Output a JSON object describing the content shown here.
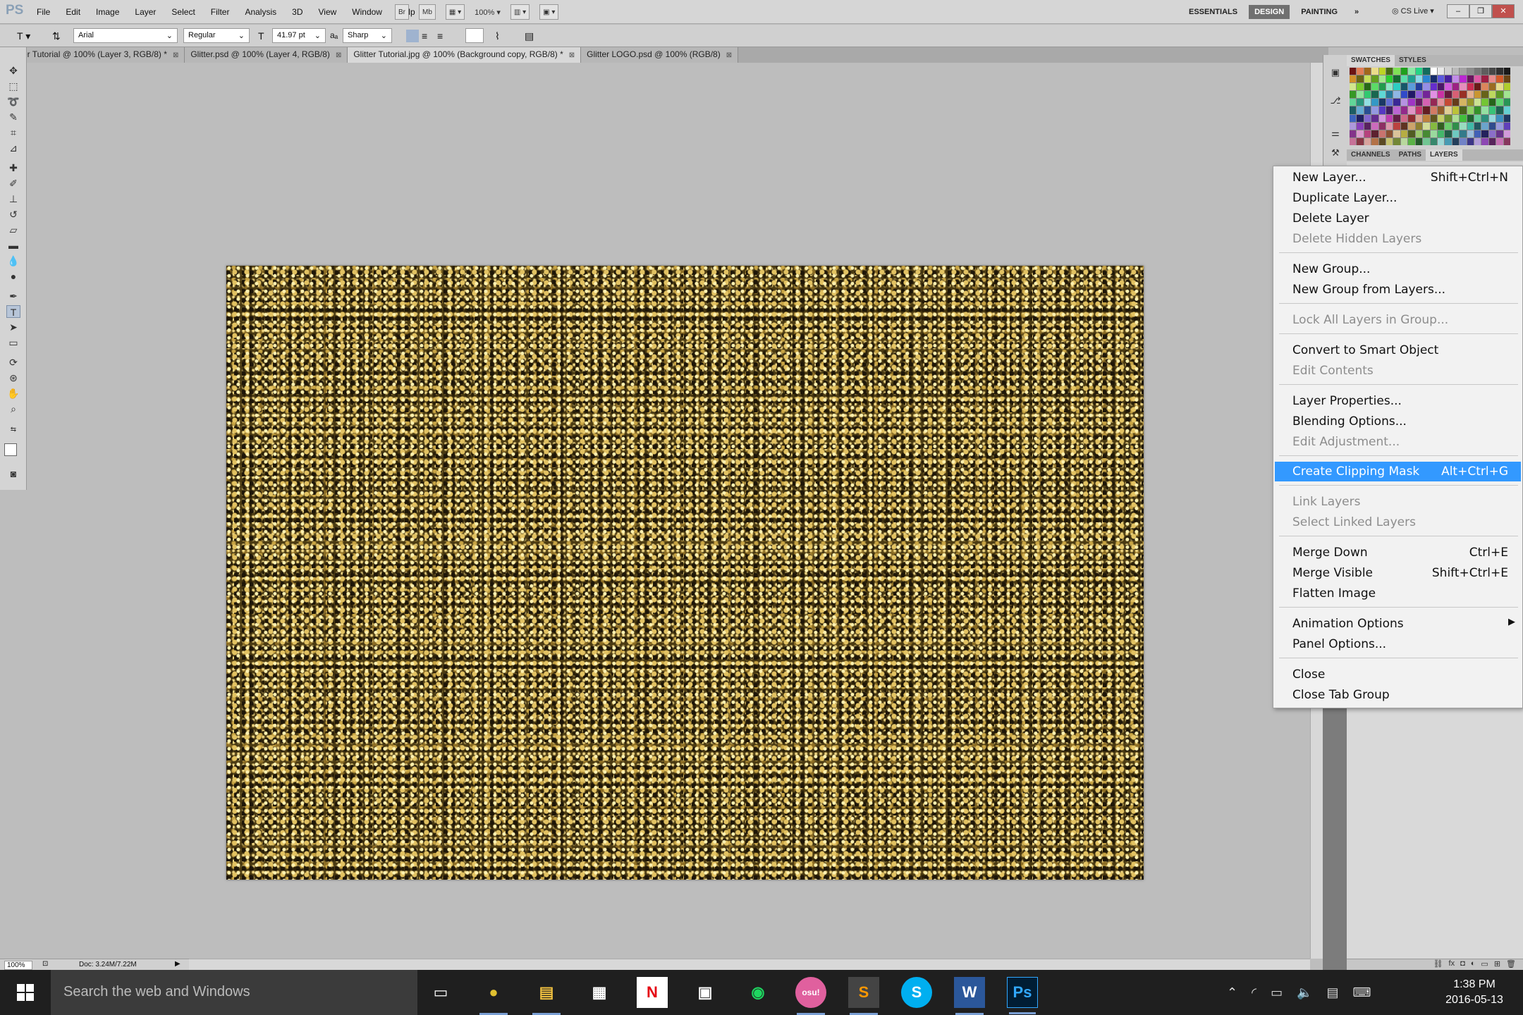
{
  "app": {
    "logo": "PS",
    "menu": [
      "File",
      "Edit",
      "Image",
      "Layer",
      "Select",
      "Filter",
      "Analysis",
      "3D",
      "View",
      "Window",
      "Help"
    ],
    "bar_buttons": [
      "Br",
      "Mb"
    ],
    "zoom": "100%",
    "workspaces": [
      "ESSENTIALS",
      "DESIGN",
      "PAINTING"
    ],
    "active_workspace": "DESIGN",
    "cs_live": "CS Live"
  },
  "options": {
    "tool_icon": "type-tool-icon",
    "font_family": "Arial",
    "font_style": "Regular",
    "font_size": "41.97 pt",
    "aa_label": "aₐ",
    "anti_alias": "Sharp"
  },
  "tabs": [
    {
      "label": "er Tutorial  @ 100% (Layer 3, RGB/8) *",
      "active": false
    },
    {
      "label": "Glitter.psd @ 100% (Layer 4, RGB/8)",
      "active": false
    },
    {
      "label": "Glitter Tutorial.jpg @ 100% (Background copy, RGB/8) *",
      "active": true
    },
    {
      "label": "Glitter LOGO.psd @ 100% (RGB/8)",
      "active": false
    }
  ],
  "status": {
    "zoom": "100%",
    "doc": "Doc: 3.24M/7.22M"
  },
  "panels": {
    "top_tabs": [
      "SWATCHES",
      "STYLES"
    ],
    "bottom_tabs": [
      "CHANNELS",
      "PATHS",
      "LAYERS"
    ]
  },
  "context_menu": [
    {
      "label": "New Layer...",
      "shortcut": "Shift+Ctrl+N",
      "disabled": false
    },
    {
      "label": "Duplicate Layer...",
      "shortcut": "",
      "disabled": false
    },
    {
      "label": "Delete Layer",
      "shortcut": "",
      "disabled": false
    },
    {
      "label": "Delete Hidden Layers",
      "shortcut": "",
      "disabled": true
    },
    {
      "label": "New Group...",
      "shortcut": "",
      "disabled": false
    },
    {
      "label": "New Group from Layers...",
      "shortcut": "",
      "disabled": false
    },
    {
      "label": "Lock All Layers in Group...",
      "shortcut": "",
      "disabled": true
    },
    {
      "label": "Convert to Smart Object",
      "shortcut": "",
      "disabled": false
    },
    {
      "label": "Edit Contents",
      "shortcut": "",
      "disabled": true
    },
    {
      "label": "Layer Properties...",
      "shortcut": "",
      "disabled": false
    },
    {
      "label": "Blending Options...",
      "shortcut": "",
      "disabled": false
    },
    {
      "label": "Edit Adjustment...",
      "shortcut": "",
      "disabled": true
    },
    {
      "label": "Create Clipping Mask",
      "shortcut": "Alt+Ctrl+G",
      "disabled": false,
      "highlighted": true
    },
    {
      "label": "Link Layers",
      "shortcut": "",
      "disabled": true
    },
    {
      "label": "Select Linked Layers",
      "shortcut": "",
      "disabled": true
    },
    {
      "label": "Merge Down",
      "shortcut": "Ctrl+E",
      "disabled": false
    },
    {
      "label": "Merge Visible",
      "shortcut": "Shift+Ctrl+E",
      "disabled": false
    },
    {
      "label": "Flatten Image",
      "shortcut": "",
      "disabled": false
    },
    {
      "label": "Animation Options",
      "shortcut": "",
      "disabled": false,
      "submenu": true
    },
    {
      "label": "Panel Options...",
      "shortcut": "",
      "disabled": false
    },
    {
      "label": "Close",
      "shortcut": "",
      "disabled": false
    },
    {
      "label": "Close Tab Group",
      "shortcut": "",
      "disabled": false
    }
  ],
  "taskbar": {
    "search_placeholder": "Search the web and Windows",
    "apps": [
      {
        "name": "task-view-icon",
        "glyph": "▭"
      },
      {
        "name": "chrome-icon",
        "glyph": "●"
      },
      {
        "name": "file-explorer-icon",
        "glyph": "▤"
      },
      {
        "name": "calendar-icon",
        "glyph": "▦"
      },
      {
        "name": "netflix-icon",
        "glyph": "N"
      },
      {
        "name": "store-icon",
        "glyph": "▣"
      },
      {
        "name": "spotify-icon",
        "glyph": "◉"
      },
      {
        "name": "osu-icon",
        "glyph": "osu!"
      },
      {
        "name": "sublime-icon",
        "glyph": "S"
      },
      {
        "name": "skype-icon",
        "glyph": "S"
      },
      {
        "name": "word-icon",
        "glyph": "W"
      },
      {
        "name": "photoshop-icon",
        "glyph": "Ps"
      }
    ],
    "time": "1:38 PM",
    "date": "2016-05-13"
  },
  "colors": {
    "highlight": "#3399ff",
    "glitter_base": "#4a3a12",
    "taskbar": "#1f1f1f"
  }
}
